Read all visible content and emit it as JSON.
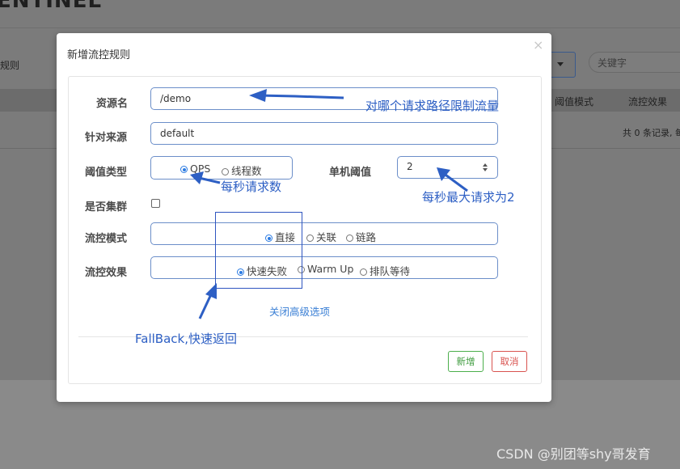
{
  "background": {
    "app_title": "ENTINEL",
    "rule_label": "规则",
    "search_placeholder": "关键字",
    "columns": [
      "阈值模式",
      "流控效果"
    ],
    "records_text": "共 0 条记录, 每"
  },
  "dialog": {
    "title": "新增流控规则",
    "close_symbol": "×",
    "resource_name": {
      "label": "资源名",
      "value": "/demo"
    },
    "limit_app": {
      "label": "针对来源",
      "value": "default"
    },
    "grade": {
      "label": "阈值类型",
      "options": [
        "QPS",
        "线程数"
      ],
      "selected": "QPS"
    },
    "count": {
      "label": "单机阈值",
      "value": "2"
    },
    "cluster": {
      "label": "是否集群",
      "checked": false
    },
    "strategy": {
      "label": "流控模式",
      "options": [
        "直接",
        "关联",
        "链路"
      ],
      "selected": "直接"
    },
    "control_behavior": {
      "label": "流控效果",
      "options": [
        "快速失败",
        "Warm Up",
        "排队等待"
      ],
      "selected": "快速失败"
    },
    "advanced_toggle": "关闭高级选项",
    "buttons": {
      "add": "新增",
      "cancel": "取消"
    }
  },
  "annotations": {
    "resource": "对哪个请求路径限制流量",
    "qps": "每秒请求数",
    "count": "每秒最大请求为2",
    "fallback": "FallBack,快速返回",
    "color": "#2d5fc4"
  },
  "watermark": "CSDN @别团等shy哥发育"
}
